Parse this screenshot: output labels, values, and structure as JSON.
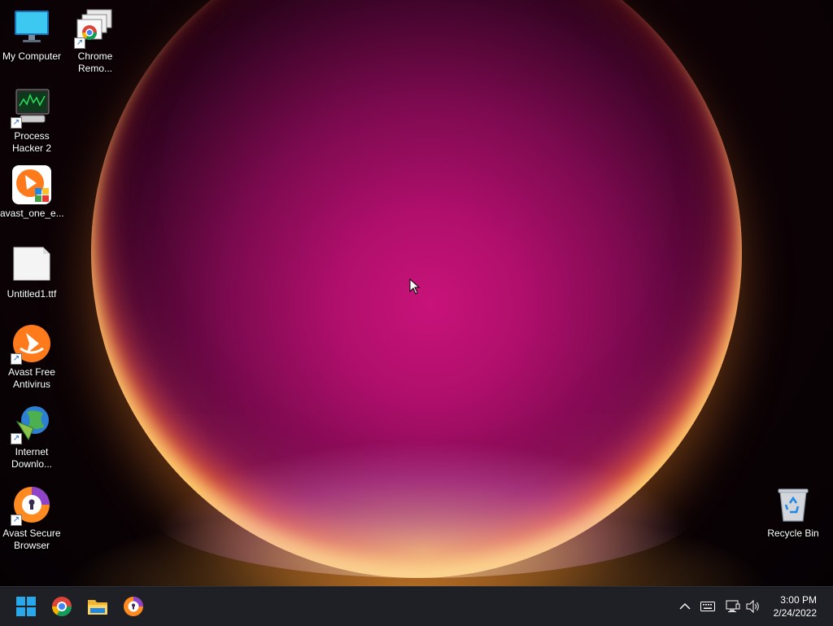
{
  "desktop": {
    "icons": [
      {
        "label": "My Computer",
        "icon": "monitor-icon"
      },
      {
        "label": "Chrome\nRemo...",
        "icon": "chrome-remote-desktop-icon"
      },
      {
        "label": "Process\nHacker 2",
        "icon": "process-hacker-icon"
      },
      {
        "label": "avast_one_e...",
        "icon": "avast-installer-icon"
      },
      {
        "label": "Untitled1.ttf",
        "icon": "blank-file-icon"
      },
      {
        "label": "Avast Free\nAntivirus",
        "icon": "avast-icon"
      },
      {
        "label": "Internet\nDownlo...",
        "icon": "internet-download-manager-icon"
      },
      {
        "label": "Avast Secure\nBrowser",
        "icon": "avast-secure-browser-icon"
      },
      {
        "label": "Recycle Bin",
        "icon": "recycle-bin-icon"
      }
    ]
  },
  "taskbar": {
    "pinned": [
      "start-icon",
      "chrome-icon",
      "file-explorer-icon",
      "avast-secure-browser-icon"
    ],
    "tray": [
      "chevron-up-icon",
      "keyboard-icon",
      "network-icon",
      "volume-icon"
    ],
    "time": "3:00 PM",
    "date": "2/24/2022"
  },
  "colors": {
    "taskbar_bg": "#1f1f26",
    "accent_orange": "#ff7a1a",
    "windows_blue": "#28a8ea"
  }
}
